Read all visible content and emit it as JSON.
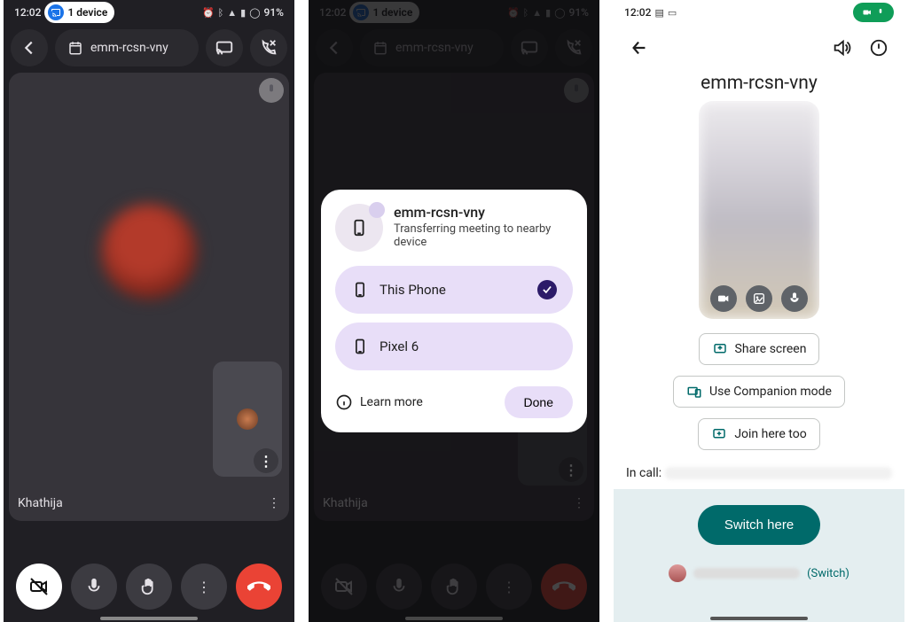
{
  "status": {
    "time": "12:02",
    "battery": "91%",
    "device_pill": "1 device"
  },
  "meeting": {
    "id": "emm-rcsn-vny",
    "participant": "Khathija"
  },
  "transfer_modal": {
    "title": "emm-rcsn-vny",
    "subtitle": "Transferring meeting to nearby device",
    "devices": [
      {
        "label": "This Phone",
        "selected": true
      },
      {
        "label": "Pixel 6",
        "selected": false
      }
    ],
    "learn_more": "Learn more",
    "done": "Done"
  },
  "join_screen": {
    "title": "emm-rcsn-vny",
    "options": {
      "share": "Share screen",
      "companion": "Use Companion mode",
      "join_too": "Join here too"
    },
    "in_call_label": "In call:",
    "switch": "Switch here",
    "switch_link": "(Switch)"
  }
}
